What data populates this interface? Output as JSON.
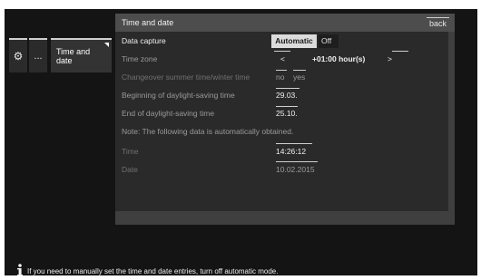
{
  "nav": {
    "settings_icon": "gear-icon",
    "more_label": "...",
    "current_label": "Time and date"
  },
  "panel": {
    "title": "Time and date",
    "back_label": "back"
  },
  "rows": {
    "data_capture": {
      "label": "Data capture",
      "active": "Automatic",
      "inactive": "Off"
    },
    "time_zone": {
      "label": "Time zone",
      "prev": "<",
      "value": "+01:00 hour(s)",
      "next": ">"
    },
    "changeover": {
      "label": "Changeover summer time/winter time",
      "no": "no",
      "yes": "yes"
    },
    "dst_begin": {
      "label": "Beginning of daylight-saving time",
      "value": "29.03."
    },
    "dst_end": {
      "label": "End of daylight-saving time",
      "value": "25.10."
    },
    "note": {
      "label": "Note: The following data is automatically obtained."
    },
    "time": {
      "label": "Time",
      "value": "14:26:12"
    },
    "date": {
      "label": "Date",
      "value": "10.02.2015"
    }
  },
  "hint": {
    "icon": "info-icon",
    "text": "If you need to manually set the time and date entries, turn off automatic mode."
  },
  "colors": {
    "screen_bg": "#141414",
    "panel_bg": "#3f3f3f",
    "list_bg": "#2a2a2a",
    "accent": "#dcdcdc"
  }
}
